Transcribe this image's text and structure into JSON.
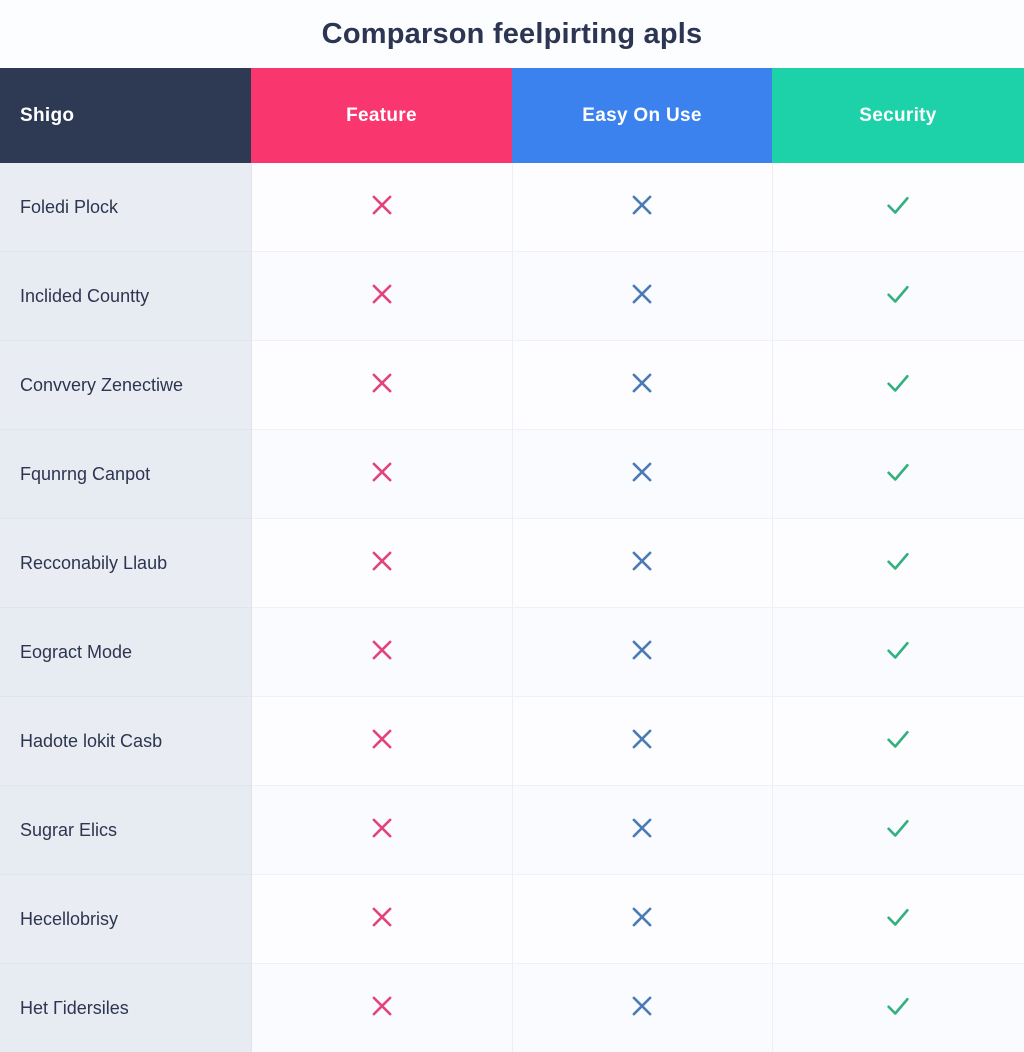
{
  "page": {
    "title": "Comparson feelpirting apls",
    "background_color": "#fbfcfe"
  },
  "colors": {
    "header_label_bg": "#2e3a54",
    "header_feature_bg": "#f9376e",
    "header_easy_bg": "#3b82ef",
    "header_security_bg": "#1dd1a8",
    "label_column_bg": "#e9edf3",
    "cross_pink": "#e0457b",
    "cross_blue": "#4a7bb5",
    "check_green": "#33b07e",
    "title_text": "#2c3552",
    "row_text": "#2d3550"
  },
  "table": {
    "columns": [
      {
        "key": "label",
        "label": "Shigo",
        "icon": null,
        "align": "left"
      },
      {
        "key": "feature",
        "label": "Feature",
        "icon": "cross-icon",
        "align": "center"
      },
      {
        "key": "easy",
        "label": "Easy On Use",
        "icon": "cross-icon",
        "align": "center"
      },
      {
        "key": "security",
        "label": "Security",
        "icon": "check-icon",
        "align": "center"
      }
    ],
    "rows": [
      {
        "label": "Foledi Plock",
        "feature": "cross",
        "easy": "cross",
        "security": "check"
      },
      {
        "label": "Inclided Countty",
        "feature": "cross",
        "easy": "cross",
        "security": "check"
      },
      {
        "label": "Convvery Zenectiwe",
        "feature": "cross",
        "easy": "cross",
        "security": "check"
      },
      {
        "label": "Fqunrng Canpot",
        "feature": "cross",
        "easy": "cross",
        "security": "check"
      },
      {
        "label": "Recconabily Llaub",
        "feature": "cross",
        "easy": "cross",
        "security": "check"
      },
      {
        "label": "Eogract Mode",
        "feature": "cross",
        "easy": "cross",
        "security": "check"
      },
      {
        "label": "Hadote lokit Casb",
        "feature": "cross",
        "easy": "cross",
        "security": "check"
      },
      {
        "label": "Sugrar Elics",
        "feature": "cross",
        "easy": "cross",
        "security": "check"
      },
      {
        "label": "Hecellobrisy",
        "feature": "cross",
        "easy": "cross",
        "security": "check"
      },
      {
        "label": "Het Гidersiles",
        "feature": "cross",
        "easy": "cross",
        "security": "check"
      }
    ]
  }
}
